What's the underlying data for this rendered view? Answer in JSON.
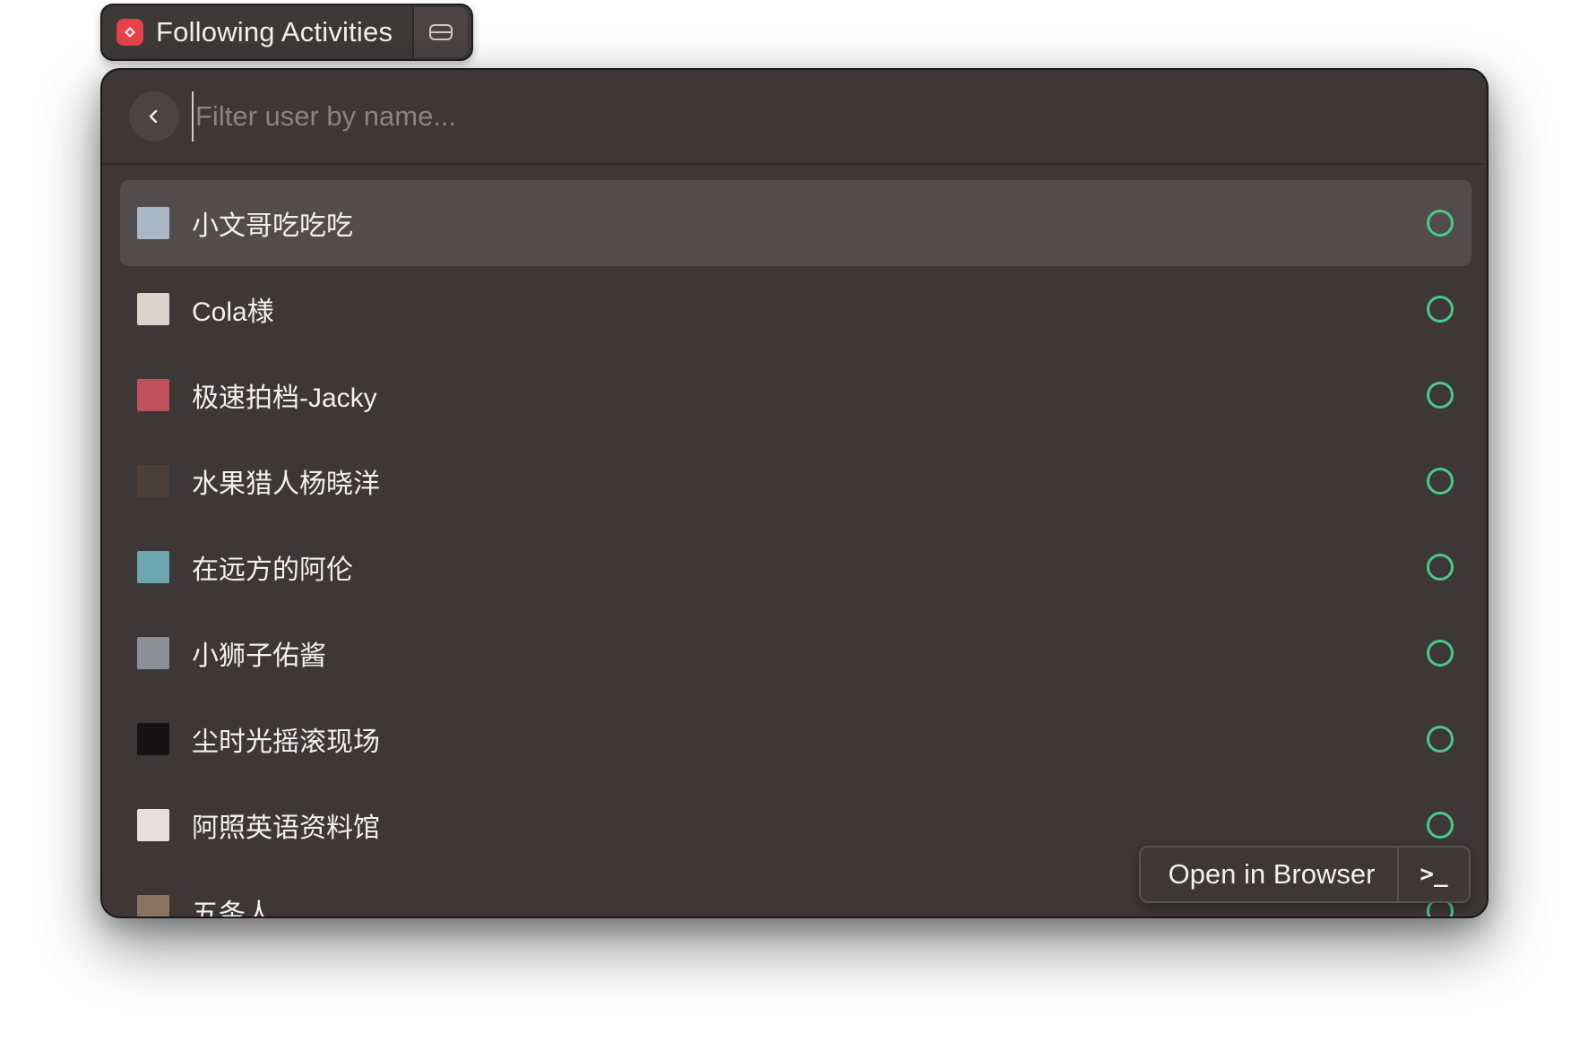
{
  "header": {
    "title": "Following Activities",
    "app_icon": "raycast-extension-icon",
    "action_icon": "tray-icon"
  },
  "search": {
    "placeholder": "Filter user by name..."
  },
  "list": {
    "items": [
      {
        "label": "小文哥吃吃吃",
        "avatar_color": "#a9b8c6",
        "selected": true
      },
      {
        "label": "Cola様",
        "avatar_color": "#d9d3cc"
      },
      {
        "label": "极速拍档-Jacky",
        "avatar_color": "#c0505a"
      },
      {
        "label": "水果猎人杨晓洋",
        "avatar_color": "#4a4038"
      },
      {
        "label": "在远方的阿伦",
        "avatar_color": "#6aa7b0"
      },
      {
        "label": "小狮子佑酱",
        "avatar_color": "#8c8f95"
      },
      {
        "label": "尘时光摇滚现场",
        "avatar_color": "#151313"
      },
      {
        "label": "阿照英语资料馆",
        "avatar_color": "#e8dede"
      },
      {
        "label": "五条人",
        "avatar_color": "#8a7460"
      }
    ],
    "status_color": "#49c98a"
  },
  "action_bar": {
    "primary": "Open in Browser",
    "toggle": ">_"
  }
}
